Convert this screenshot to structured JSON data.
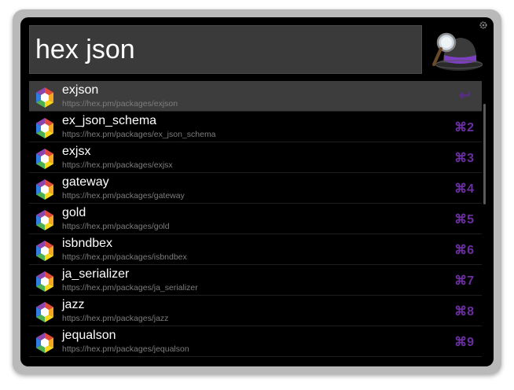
{
  "search": {
    "query": "hex json"
  },
  "results": [
    {
      "title": "exjson",
      "url": "https://hex.pm/packages/exjson",
      "shortcut": "↩",
      "selected": true
    },
    {
      "title": "ex_json_schema",
      "url": "https://hex.pm/packages/ex_json_schema",
      "shortcut": "⌘2"
    },
    {
      "title": "exjsx",
      "url": "https://hex.pm/packages/exjsx",
      "shortcut": "⌘3"
    },
    {
      "title": "gateway",
      "url": "https://hex.pm/packages/gateway",
      "shortcut": "⌘4"
    },
    {
      "title": "gold",
      "url": "https://hex.pm/packages/gold",
      "shortcut": "⌘5"
    },
    {
      "title": "isbndbex",
      "url": "https://hex.pm/packages/isbndbex",
      "shortcut": "⌘6"
    },
    {
      "title": "ja_serializer",
      "url": "https://hex.pm/packages/ja_serializer",
      "shortcut": "⌘7"
    },
    {
      "title": "jazz",
      "url": "https://hex.pm/packages/jazz",
      "shortcut": "⌘8"
    },
    {
      "title": "jequalson",
      "url": "https://hex.pm/packages/jequalson",
      "shortcut": "⌘9"
    }
  ],
  "icons": {
    "result": "hex-package-icon",
    "app": "alfred-hat-icon",
    "settings": "gear-icon"
  },
  "colors": {
    "shortcut": "#6a2ea0",
    "selected_row": "#3d3d3d",
    "query_bg": "#3a3a3a"
  }
}
